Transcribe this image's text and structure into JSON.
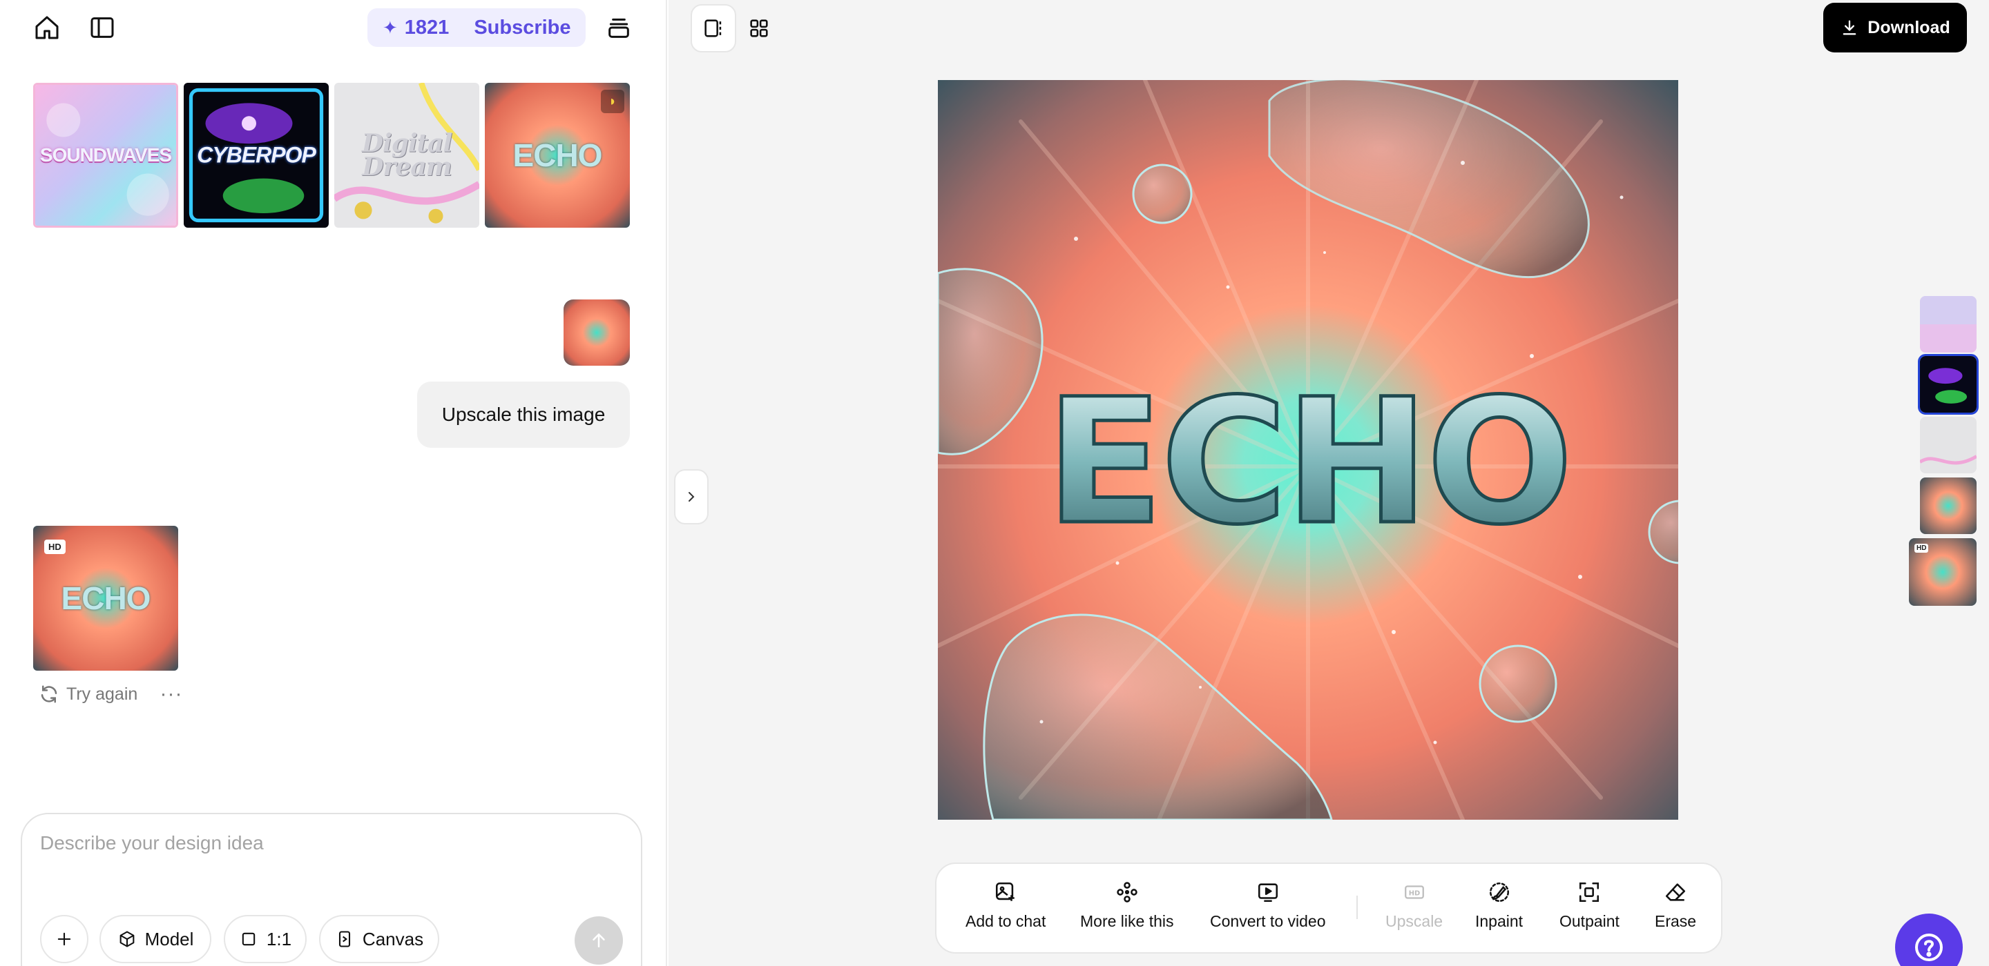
{
  "header": {
    "credits_count": "1821",
    "subscribe_label": "Subscribe"
  },
  "gallery": [
    {
      "label": "SOUNDWAVES"
    },
    {
      "label": "CYBERPOP"
    },
    {
      "label": "Digital Dream"
    },
    {
      "label": "ECHO"
    }
  ],
  "chat": {
    "user_message": "Upscale this image",
    "result_badge": "HD",
    "try_again_label": "Try again",
    "more_label": "···"
  },
  "composer": {
    "placeholder": "Describe your design idea",
    "model_label": "Model",
    "ratio_label": "1:1",
    "canvas_label": "Canvas"
  },
  "canvas": {
    "download_label": "Download",
    "main_image_text": "ECHO",
    "side_thumb_badge": "HD"
  },
  "toolbar": {
    "add_to_chat": "Add to chat",
    "more_like_this": "More like this",
    "convert_to_video": "Convert to video",
    "upscale": "Upscale",
    "inpaint": "Inpaint",
    "outpaint": "Outpaint",
    "erase": "Erase"
  },
  "colors": {
    "accent": "#5b4ce0",
    "help_button": "#5b3be8",
    "selected_outline": "#2545d6"
  }
}
